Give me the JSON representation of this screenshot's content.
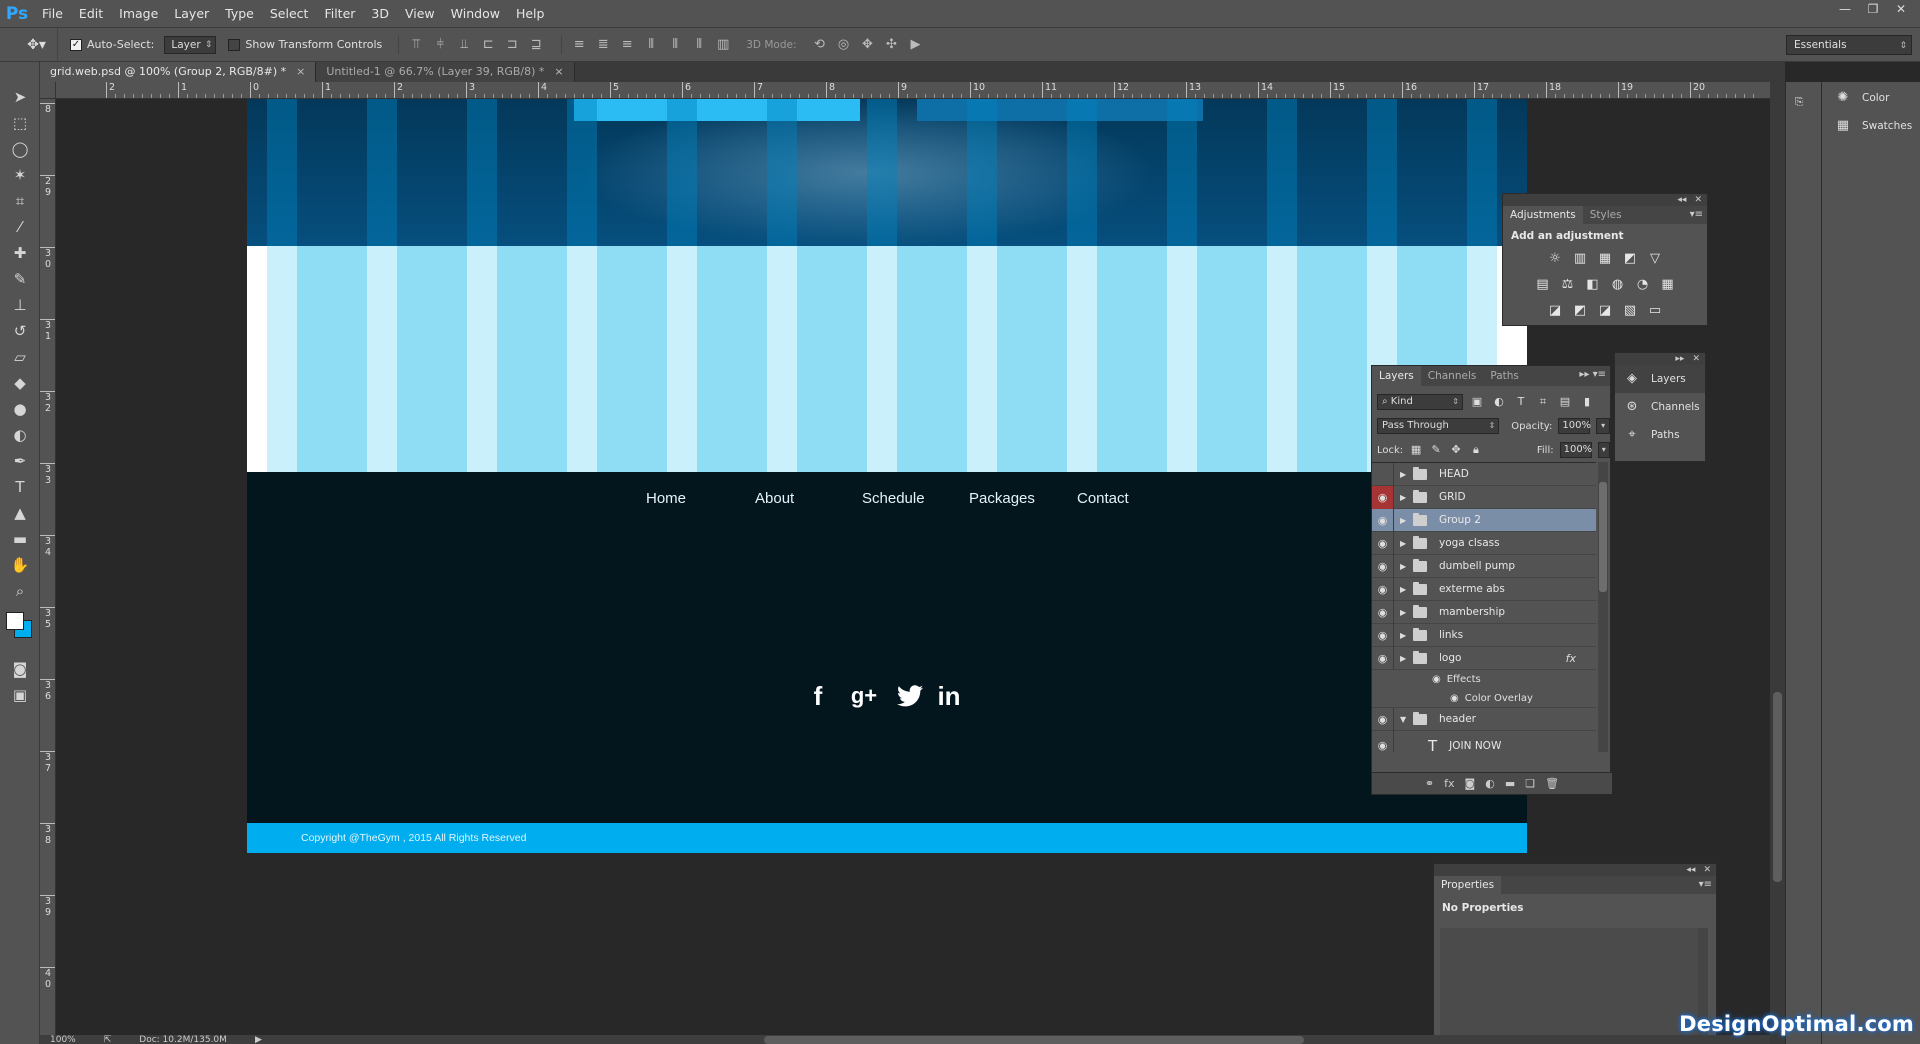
{
  "app": {
    "logo": "Ps",
    "menu": [
      "File",
      "Edit",
      "Image",
      "Layer",
      "Type",
      "Select",
      "Filter",
      "3D",
      "View",
      "Window",
      "Help"
    ],
    "window_controls": {
      "minimize": "—",
      "restore": "❐",
      "close": "✕"
    }
  },
  "options_bar": {
    "auto_select_label": "Auto-Select:",
    "auto_select_target": "Layer",
    "show_transform_label": "Show Transform Controls",
    "mode_3d_label": "3D Mode:",
    "workspace": "Essentials"
  },
  "tabs": [
    {
      "label": "grid.web.psd @ 100% (Group 2, RGB/8#) *",
      "active": true
    },
    {
      "label": "Untitled-1 @ 66.7% (Layer 39, RGB/8) *",
      "active": false
    }
  ],
  "ruler": {
    "h_labels": [
      "2",
      "1",
      "0",
      "1",
      "2",
      "3",
      "4",
      "5",
      "6",
      "7",
      "8",
      "9",
      "10",
      "11",
      "12",
      "13",
      "14",
      "15",
      "16",
      "17",
      "18",
      "19",
      "20"
    ],
    "v_labels": [
      "8",
      "2 9",
      "3 0",
      "3 1",
      "3 2",
      "3 3",
      "3 4",
      "3 5",
      "3 6",
      "3 7",
      "3 8",
      "3 9",
      "4 0"
    ]
  },
  "document": {
    "nav": [
      "Home",
      "About",
      "Schedule",
      "Packages",
      "Contact"
    ],
    "social": [
      "f",
      "g+",
      "t",
      "in"
    ],
    "social_icons": [
      "facebook-icon",
      "google-plus-icon",
      "twitter-icon",
      "linkedin-icon"
    ],
    "copyright": "Copyright @TheGym , 2015 All Rights Reserved",
    "colors": {
      "hero": "#064f7e",
      "grid_light": "#c9f0fb",
      "grid_dark": "#8fdcf5",
      "footer": "#03151d",
      "copyright_bar": "#00adef"
    }
  },
  "adjustments": {
    "tabs": [
      "Adjustments",
      "Styles"
    ],
    "title": "Add an adjustment",
    "icons_row1": [
      "☼",
      "▥",
      "▦",
      "◩",
      "▽"
    ],
    "icons_row2": [
      "▤",
      "⚖",
      "◧",
      "◍",
      "◔",
      "▦"
    ],
    "icons_row3": [
      "◪",
      "◩",
      "◪",
      "▧",
      "▭"
    ]
  },
  "layers_panel": {
    "tabs": [
      "Layers",
      "Channels",
      "Paths"
    ],
    "filter": "Kind",
    "blend_mode": "Pass Through",
    "opacity_label": "Opacity:",
    "opacity": "100%",
    "lock_label": "Lock:",
    "fill_label": "Fill:",
    "fill": "100%",
    "layers": [
      {
        "name": "HEAD",
        "visible": false,
        "selected": false
      },
      {
        "name": "GRID",
        "visible": true,
        "selected": false
      },
      {
        "name": "Group 2",
        "visible": true,
        "selected": true
      },
      {
        "name": "yoga clsass",
        "visible": true,
        "selected": false
      },
      {
        "name": "dumbell pump",
        "visible": true,
        "selected": false
      },
      {
        "name": "exterme abs",
        "visible": true,
        "selected": false
      },
      {
        "name": "mambership",
        "visible": true,
        "selected": false
      },
      {
        "name": "links",
        "visible": true,
        "selected": false
      },
      {
        "name": "logo",
        "visible": true,
        "selected": false
      }
    ],
    "effects_label": "Effects",
    "color_overlay_label": "Color Overlay",
    "header_layer": "header",
    "text_layer": "JOIN NOW",
    "fx_label": "fx"
  },
  "collapsed_panel": {
    "items": [
      "Layers",
      "Channels",
      "Paths"
    ]
  },
  "dock": {
    "items": [
      "Color",
      "Swatches"
    ]
  },
  "properties": {
    "tab": "Properties",
    "body": "No Properties"
  },
  "status": {
    "zoom": "100%",
    "doc": "Doc: 10.2M/135.0M"
  },
  "watermark": "DesignOptimal.com"
}
